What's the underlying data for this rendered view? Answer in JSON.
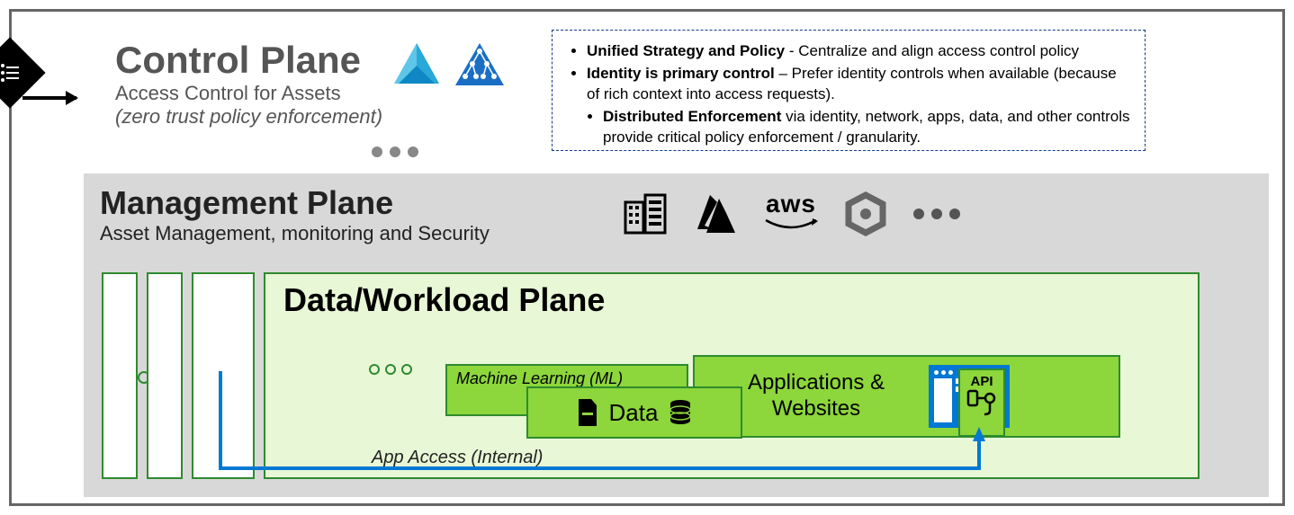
{
  "control": {
    "title": "Control Plane",
    "subtitle": "Access Control for Assets",
    "note": "(zero trust policy enforcement)"
  },
  "policy": {
    "b1": "Unified Strategy and Policy",
    "t1": " - Centralize and align access control policy",
    "b2": "Identity is primary control",
    "t2": " – Prefer identity controls when available (because of rich context into access requests).",
    "b3": "Distributed Enforcement",
    "t3": " via identity, network, apps, data, and other controls provide critical policy enforcement / granularity."
  },
  "mgmt": {
    "title": "Management Plane",
    "subtitle": "Asset Management, monitoring and Security"
  },
  "dwp": {
    "title": "Data/Workload Plane",
    "ml": "Machine Learning (ML)",
    "data": "Data",
    "apps": "Applications & Websites",
    "api": "API"
  },
  "app_access": "App Access (Internal)",
  "cloud_labels": {
    "aws": "aws"
  }
}
